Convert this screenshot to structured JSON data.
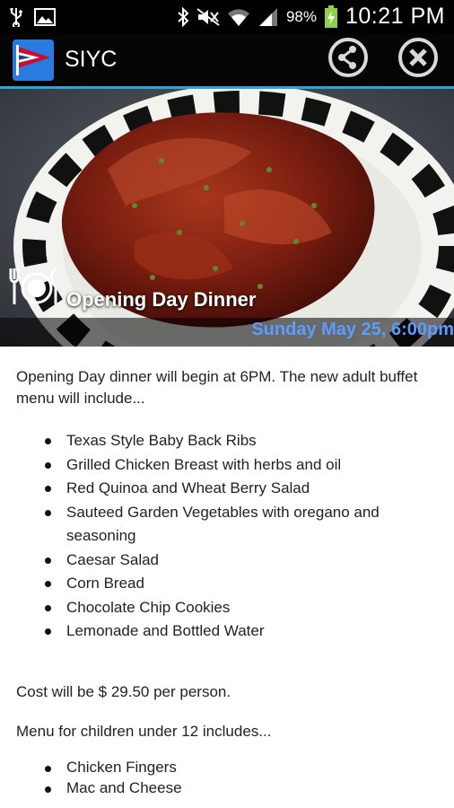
{
  "statusbar": {
    "battery_pct": "98%",
    "time": "10:21 PM",
    "icons": [
      "usb-icon",
      "image-icon",
      "bluetooth-icon",
      "mute-icon",
      "wifi-icon",
      "signal-icon",
      "battery-charging-icon"
    ]
  },
  "appbar": {
    "title": "SIYC",
    "actions": [
      "share-icon",
      "close-icon"
    ]
  },
  "event": {
    "title": "Opening Day Dinner",
    "date": "Sunday May 25, 6:00pm",
    "intro": "Opening Day dinner will begin at 6PM. The new adult buffet menu will include...",
    "adult_menu": [
      "Texas Style Baby Back Ribs",
      "Grilled Chicken Breast with herbs and oil",
      "Red Quinoa and Wheat Berry Salad",
      "Sauteed Garden Vegetables with oregano and seasoning",
      "Caesar Salad",
      "Corn Bread",
      "Chocolate Chip Cookies",
      "Lemonade and Bottled Water"
    ],
    "cost": "Cost will be $ 29.50 per person.",
    "children_intro": "Menu for children under 12 includes...",
    "children_menu": [
      "Chicken Fingers",
      "Mac and Cheese"
    ]
  },
  "colors": {
    "accent": "#2aa3de",
    "date": "#5b9cff",
    "appbar": "#050505"
  }
}
